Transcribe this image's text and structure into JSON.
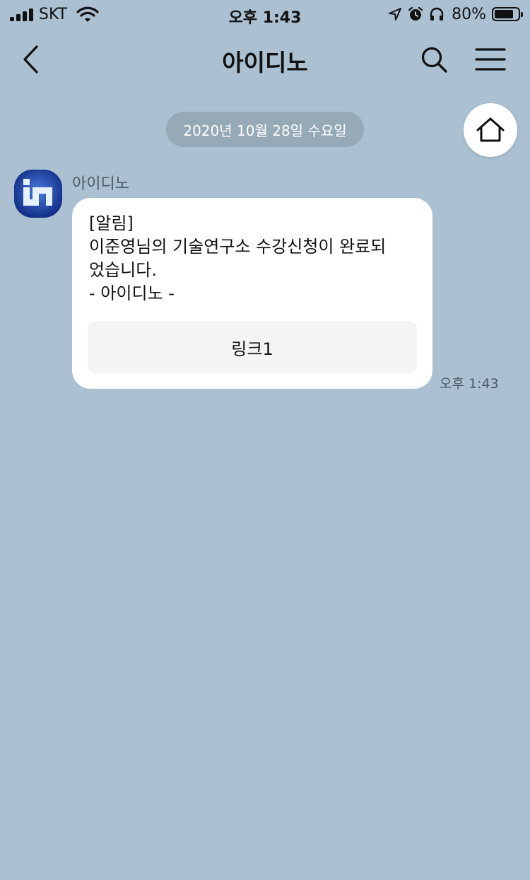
{
  "status_bar": {
    "carrier": "SKT",
    "time": "오후 1:43",
    "battery_percent": "80%",
    "battery_level": 0.8,
    "icons": [
      "signal-icon",
      "wifi-icon",
      "location-arrow-icon",
      "alarm-icon",
      "headphones-icon",
      "battery-icon"
    ]
  },
  "nav": {
    "title": "아이디노",
    "icons": [
      "back-arrow-icon",
      "search-icon",
      "hamburger-menu-icon"
    ]
  },
  "chat": {
    "date_divider": "2020년 10월 28일 수요일",
    "home_icon": "home-icon",
    "message": {
      "sender": "아이디노",
      "lines": [
        "[알림]",
        "이준영님의 기술연구소 수강신청이 완료되",
        "었습니다.",
        "- 아이디노 -"
      ],
      "button_label": "링크1",
      "time": "오후 1:43"
    }
  },
  "colors": {
    "background": "#abc1d1",
    "bubble": "#ffffff",
    "date_chip": "#96a9b7",
    "link_button": "#f4f4f4",
    "avatar": "#1f3fa0"
  }
}
